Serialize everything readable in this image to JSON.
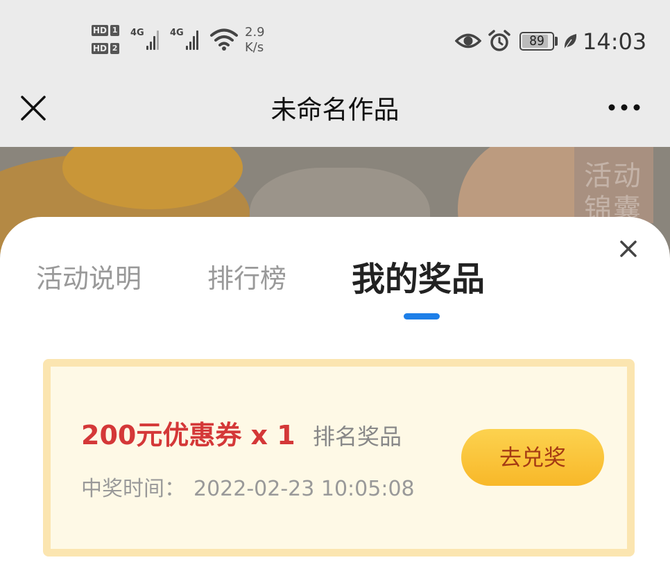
{
  "status_bar": {
    "sim1": {
      "badge": "HD",
      "slot": "1"
    },
    "sim2": {
      "badge": "HD",
      "slot": "2"
    },
    "signal1_label": "4G",
    "signal2_label": "4G",
    "net_speed_value": "2.9",
    "net_speed_unit": "K/s",
    "battery": "89",
    "battery_level": 0.89,
    "time": "14:03",
    "icons": [
      "wifi-icon",
      "eye-icon",
      "alarm-icon",
      "battery-icon",
      "leaf-icon"
    ]
  },
  "title_bar": {
    "title": "未命名作品",
    "icons": [
      "close-icon",
      "more-icon"
    ]
  },
  "banner": {
    "tag_text": "活动锦囊"
  },
  "sheet": {
    "tabs": [
      {
        "label": "活动说明",
        "active": false
      },
      {
        "label": "排行榜",
        "active": false
      },
      {
        "label": "我的奖品",
        "active": true
      }
    ],
    "accent_color": "#1e7fe8",
    "prize": {
      "name": "200元优惠券 x 1",
      "type": "排名奖品",
      "time_label": "中奖时间：",
      "time_value": "2022-02-23 10:05:08",
      "button_label": "去兑奖",
      "name_color": "#d43838"
    }
  }
}
